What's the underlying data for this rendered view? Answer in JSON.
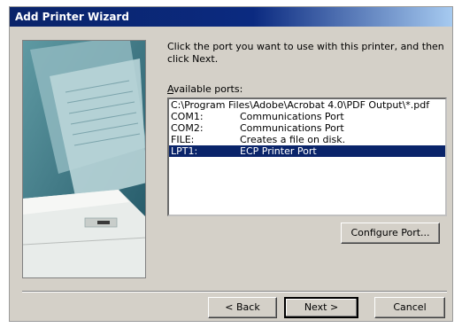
{
  "window": {
    "title": "Add Printer Wizard"
  },
  "instructions": "Click the port you want to use with this printer, and then click Next.",
  "ports_label": {
    "prefix": "",
    "accel": "A",
    "rest": "vailable ports:"
  },
  "ports": [
    {
      "name": "C:\\Program Files\\Adobe\\Acrobat 4.0\\PDF Output\\*.pdf",
      "desc": ""
    },
    {
      "name": "COM1:",
      "desc": "Communications Port"
    },
    {
      "name": "COM2:",
      "desc": "Communications Port"
    },
    {
      "name": "FILE:",
      "desc": "Creates a file on disk."
    },
    {
      "name": "LPT1:",
      "desc": "ECP Printer Port",
      "selected": true
    }
  ],
  "buttons": {
    "configure": "Configure Port...",
    "back": "< Back",
    "next": "Next >",
    "cancel": "Cancel"
  },
  "colors": {
    "title_active": "#0a246a",
    "selection": "#0a246a",
    "face": "#d4d0c8"
  }
}
